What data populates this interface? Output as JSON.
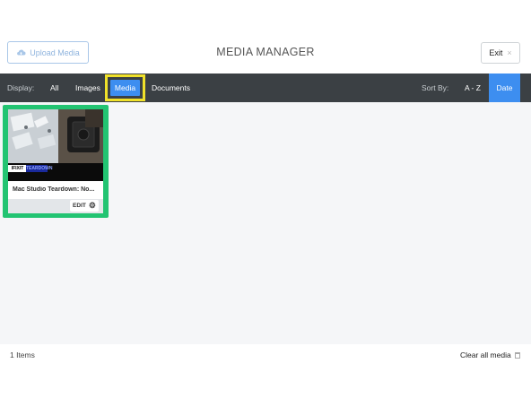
{
  "header": {
    "upload_label": "Upload Media",
    "title": "MEDIA MANAGER",
    "exit_label": "Exit",
    "exit_icon": "×"
  },
  "toolbar": {
    "display_label": "Display:",
    "filters": [
      "All",
      "Images",
      "Media",
      "Documents"
    ],
    "active_filter": "Media",
    "sort_label": "Sort By:",
    "sort_options": [
      "A - Z",
      "Date"
    ],
    "active_sort": "Date"
  },
  "media_items": [
    {
      "title": "Mac Studio Teardown: No...",
      "thumb_brand": "IFIXIT",
      "thumb_tag": "TEARDOWN",
      "edit_label": "EDIT"
    }
  ],
  "footer": {
    "count": "1 Items",
    "clear_label": "Clear all media"
  },
  "colors": {
    "toolbar_bg": "#3b4044",
    "accent_blue": "#3d8ef0",
    "highlight_yellow": "#f0e12a",
    "highlight_green": "#22c472"
  }
}
